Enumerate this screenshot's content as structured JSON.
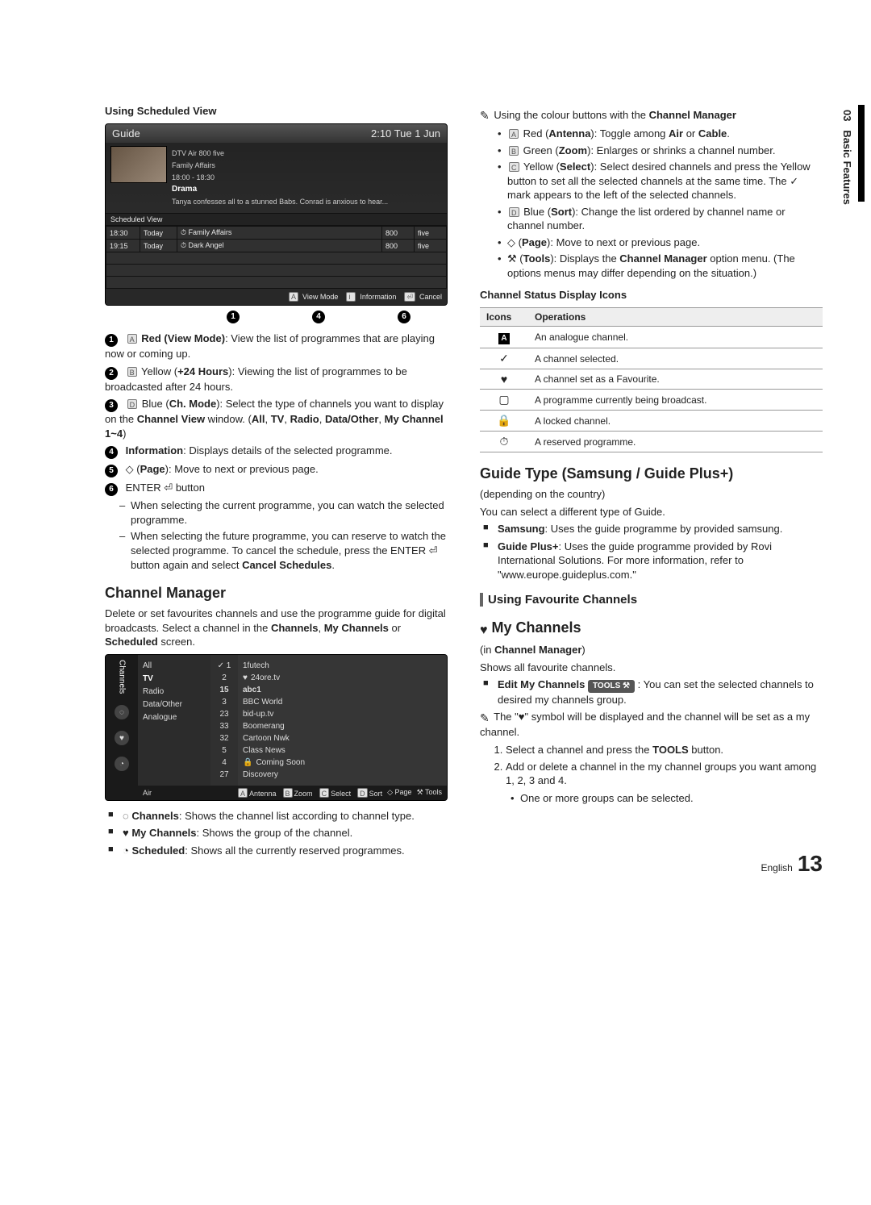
{
  "side": {
    "section_no": "03",
    "section_title": "Basic Features"
  },
  "left": {
    "using_heading": "Using Scheduled View",
    "guide": {
      "title": "Guide",
      "clock": "2:10 Tue 1 Jun",
      "meta_line1": "DTV Air 800 five",
      "meta_line2": "Family Affairs",
      "meta_line3": "18:00 - 18:30",
      "meta_genre": "Drama",
      "meta_desc": "Tanya confesses all to a stunned Babs. Conrad is anxious to hear...",
      "sched_label": "Scheduled View",
      "rows": [
        {
          "time": "18:30",
          "day": "Today",
          "prog": "Family Affairs",
          "num": "800",
          "ch": "five"
        },
        {
          "time": "19:15",
          "day": "Today",
          "prog": "Dark Angel",
          "num": "800",
          "ch": "five"
        }
      ],
      "ftr_view": "View Mode",
      "ftr_info": "Information",
      "ftr_cancel": "Cancel",
      "callouts": [
        "1",
        "4",
        "6"
      ]
    },
    "items": [
      {
        "n": "1",
        "btn": "A",
        "title": "Red (View Mode)",
        "text": ": View the list of programmes that are playing now or coming up."
      },
      {
        "n": "2",
        "btn": "B",
        "title": "Yellow (+24 Hours)",
        "text": ": Viewing the list of programmes to be broadcasted after 24 hours."
      },
      {
        "n": "3",
        "btn": "D",
        "title": "Blue (Ch. Mode)",
        "text": ": Select the type of channels you want to display on the Channel View window. (All, TV, Radio, Data/Other, My Channel 1~4)"
      },
      {
        "n": "4",
        "btn": "",
        "title": "Information",
        "text": ": Displays details of the selected programme."
      },
      {
        "n": "5",
        "btn": "◇",
        "title": "(Page)",
        "text": ": Move to next or previous page."
      },
      {
        "n": "6",
        "btn": "",
        "title": "ENTER ⏎ button",
        "text": ""
      }
    ],
    "item6_subs": [
      "When selecting the current programme, you can watch the selected programme.",
      "When selecting the future programme, you can reserve to watch the selected programme. To cancel the schedule, press the ENTER ⏎ button again and select Cancel Schedules."
    ],
    "cm_heading": "Channel Manager",
    "cm_intro": "Delete or set favourites channels and use the programme guide for digital broadcasts. Select a channel in the Channels, My Channels or Scheduled screen.",
    "cm": {
      "side_label": "Channels",
      "types": [
        "All",
        "TV",
        "Radio",
        "Data/Other",
        "Analogue"
      ],
      "type_selected_index": 1,
      "col_nums_header_check": "✓ 1",
      "nums": [
        "2",
        "15",
        "3",
        "23",
        "33",
        "32",
        "5",
        "4",
        "27"
      ],
      "names_header": "1futech",
      "names": [
        "24ore.tv",
        "abc1",
        "BBC World",
        "bid-up.tv",
        "Boomerang",
        "Cartoon Nwk",
        "Class News",
        "Coming Soon",
        "Discovery"
      ],
      "fav_row_index": 0,
      "lock_row_index": 7,
      "ftr_left": "Air",
      "ftr_tools": [
        "Antenna",
        "Zoom",
        "Select",
        "Sort",
        "Page",
        "Tools"
      ],
      "ftr_tool_btns": [
        "A",
        "B",
        "C",
        "D",
        "◇",
        "⚒"
      ]
    },
    "cm_list": [
      {
        "icon": "◌",
        "title": "Channels",
        "text": ": Shows the channel list according to channel type."
      },
      {
        "icon": "♥",
        "title": "My Channels",
        "text": ": Shows the group of the channel."
      },
      {
        "icon": "◔",
        "title": "Scheduled",
        "text": ": Shows all the currently reserved programmes."
      }
    ]
  },
  "right": {
    "note_intro": "Using the colour buttons with the Channel Manager",
    "colour_list": [
      {
        "btn": "A",
        "title": "Red (Antenna)",
        "text": ": Toggle among Air or Cable."
      },
      {
        "btn": "B",
        "title": "Green (Zoom)",
        "text": ": Enlarges or shrinks a channel number."
      },
      {
        "btn": "C",
        "title": "Yellow (Select)",
        "text": ": Select desired channels and press the Yellow button to set all the selected channels at the same time. The ✓ mark appears to the left of the selected channels."
      },
      {
        "btn": "D",
        "title": "Blue (Sort)",
        "text": ": Change the list ordered by channel name or channel number."
      },
      {
        "btn": "◇",
        "title": "(Page)",
        "text": ": Move to next or previous page."
      },
      {
        "btn": "⚒",
        "title": "(Tools)",
        "text": ": Displays the Channel Manager option menu. (The options menus may differ depending on the situation.)"
      }
    ],
    "status_heading": "Channel Status Display Icons",
    "status_table": {
      "h1": "Icons",
      "h2": "Operations",
      "rows": [
        {
          "icon": "A̲",
          "op": "An analogue channel."
        },
        {
          "icon": "✓",
          "op": "A channel selected."
        },
        {
          "icon": "♥",
          "op": "A channel set as a Favourite."
        },
        {
          "icon": "▢",
          "op": "A programme currently being broadcast."
        },
        {
          "icon": "🔒",
          "op": "A locked channel."
        },
        {
          "icon": "⏱",
          "op": "A reserved programme."
        }
      ]
    },
    "guide_type_heading": "Guide Type (Samsung / Guide Plus+)",
    "guide_type_sub": "(depending on the country)",
    "guide_type_intro": "You can select a different type of Guide.",
    "guide_type_list": [
      {
        "title": "Samsung",
        "text": ": Uses the guide programme by provided samsung."
      },
      {
        "title": "Guide Plus+",
        "text": ": Uses the guide programme provided by Rovi International Solutions. For more information, refer to \"www.europe.guideplus.com.\""
      }
    ],
    "fav_heading": "Using Favourite Channels",
    "mych_heading": "My Channels",
    "mych_sub": "(in Channel Manager)",
    "mych_intro": "Shows all favourite channels.",
    "mych_edit_title": "Edit My Channels",
    "mych_edit_pill": "TOOLS ⚒",
    "mych_edit_text": ": You can set the selected channels to desired my channels group.",
    "mych_note": "The \"♥\" symbol will be displayed and the channel will be set as a my channel.",
    "mych_steps": [
      "Select a channel and press the TOOLS button.",
      "Add or delete a channel in the my channel groups you want among 1, 2, 3 and 4."
    ],
    "mych_step2_bullet": "One or more groups can be selected."
  },
  "footer": {
    "lang": "English",
    "page": "13"
  }
}
